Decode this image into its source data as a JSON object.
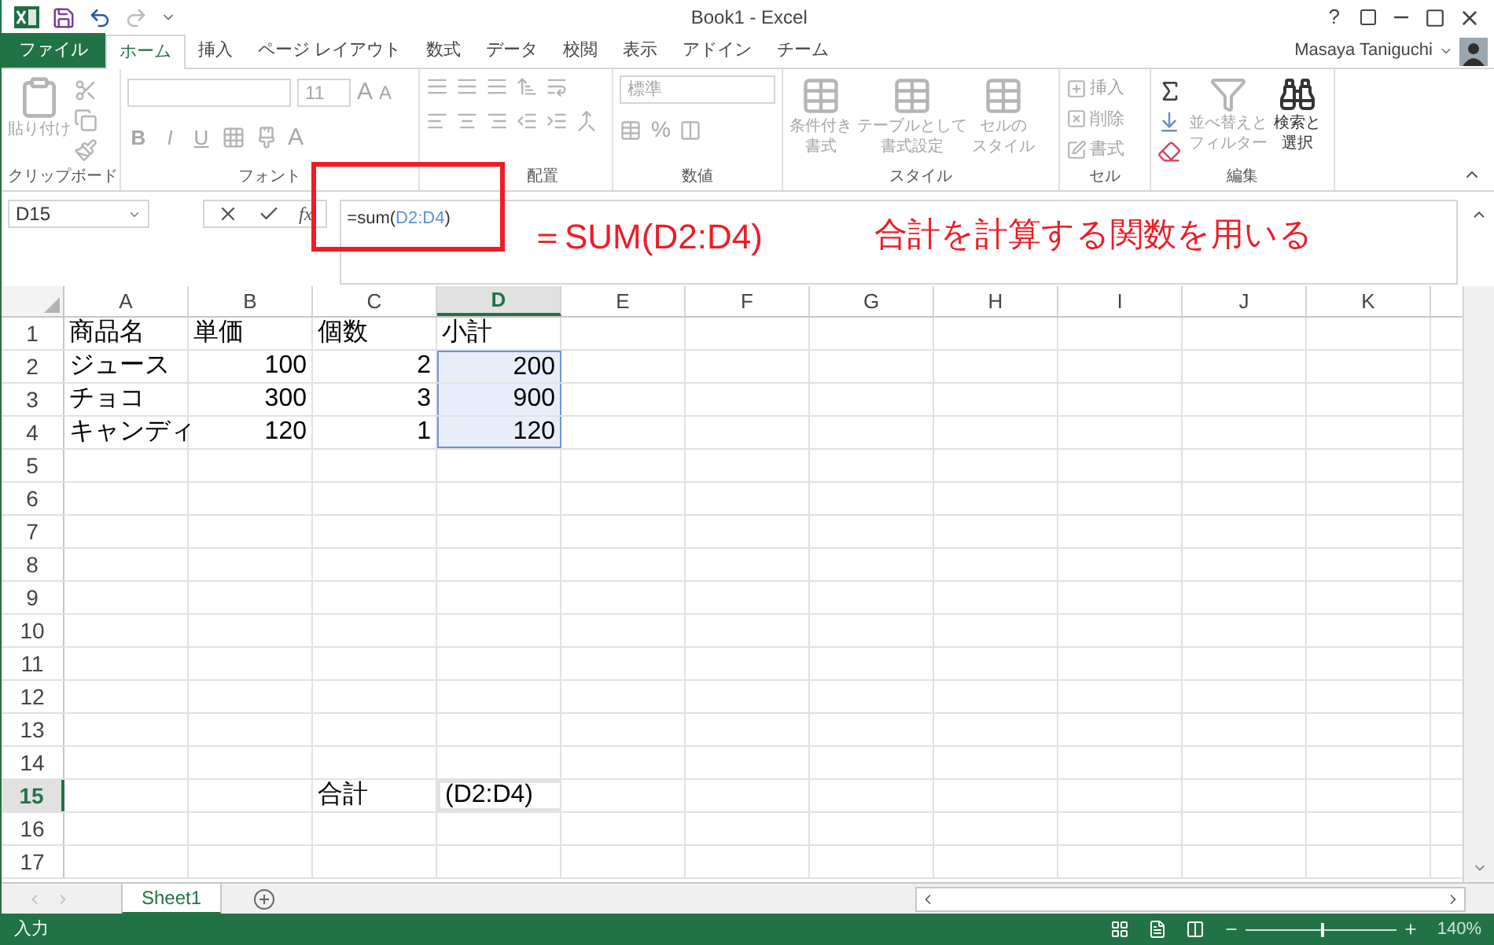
{
  "window": {
    "title": "Book1 - Excel",
    "help": "?"
  },
  "tabs": [
    {
      "label": "ファイル",
      "kind": "file",
      "selected": false
    },
    {
      "label": "ホーム",
      "kind": "tab",
      "selected": true
    },
    {
      "label": "挿入",
      "kind": "tab",
      "selected": false
    },
    {
      "label": "ページ レイアウト",
      "kind": "tab",
      "selected": false
    },
    {
      "label": "数式",
      "kind": "tab",
      "selected": false
    },
    {
      "label": "データ",
      "kind": "tab",
      "selected": false
    },
    {
      "label": "校閲",
      "kind": "tab",
      "selected": false
    },
    {
      "label": "表示",
      "kind": "tab",
      "selected": false
    },
    {
      "label": "アドイン",
      "kind": "tab",
      "selected": false
    },
    {
      "label": "チーム",
      "kind": "tab",
      "selected": false
    }
  ],
  "user": {
    "name": "Masaya Taniguchi"
  },
  "ribbon": {
    "groups": [
      {
        "label": "クリップボード",
        "kind": "clipboard",
        "buttons": [
          {
            "lines": [
              "貼り付け"
            ]
          }
        ]
      },
      {
        "label": "フォント",
        "kind": "font",
        "size": "11",
        "styles": [
          "B",
          "I",
          "U"
        ],
        "grow_letter": "A",
        "shrink_letter": "A",
        "color_letter": "A"
      },
      {
        "label": "配置",
        "kind": "align"
      },
      {
        "label": "数値",
        "kind": "number",
        "format": "標準",
        "percent": "%"
      },
      {
        "label": "スタイル",
        "kind": "styles",
        "buttons": [
          {
            "lines": [
              "条件付き",
              "書式"
            ]
          },
          {
            "lines": [
              "テーブルとして",
              "書式設定"
            ]
          },
          {
            "lines": [
              "セルの",
              "スタイル"
            ]
          }
        ]
      },
      {
        "label": "セル",
        "kind": "cells",
        "buttons": [
          {
            "lines": [
              "挿入"
            ]
          },
          {
            "lines": [
              "削除"
            ]
          },
          {
            "lines": [
              "書式"
            ]
          }
        ]
      },
      {
        "label": "編集",
        "kind": "edit",
        "buttons": [
          {
            "lines": [
              "並べ替えと",
              "フィルター"
            ],
            "disabled": true
          },
          {
            "lines": [
              "検索と",
              "選択"
            ],
            "disabled": false
          }
        ]
      }
    ]
  },
  "formula_bar": {
    "name_box": "D15",
    "fx": "fx",
    "formula": [
      {
        "text": "=sum(",
        "kind": "plain"
      },
      {
        "text": "D2:D4",
        "kind": "ref"
      },
      {
        "text": ")",
        "kind": "plain"
      }
    ]
  },
  "annotations": [
    {
      "text": "＝SUM(D2:D4)"
    },
    {
      "text": "合計を計算する関数を用いる"
    }
  ],
  "sheet": {
    "columns": [
      {
        "label": "A",
        "selected": false
      },
      {
        "label": "B",
        "selected": false
      },
      {
        "label": "C",
        "selected": false
      },
      {
        "label": "D",
        "selected": true
      },
      {
        "label": "E",
        "selected": false
      },
      {
        "label": "F",
        "selected": false
      },
      {
        "label": "G",
        "selected": false
      },
      {
        "label": "H",
        "selected": false
      },
      {
        "label": "I",
        "selected": false
      },
      {
        "label": "J",
        "selected": false
      },
      {
        "label": "K",
        "selected": false
      }
    ],
    "rows": [
      {
        "label": "1",
        "selected": false,
        "cells": [
          {
            "text": "商品名",
            "kind": "text"
          },
          {
            "text": "単価",
            "kind": "text"
          },
          {
            "text": "個数",
            "kind": "text"
          },
          {
            "text": "小計",
            "kind": "text"
          }
        ]
      },
      {
        "label": "2",
        "selected": false,
        "cells": [
          {
            "text": "ジュース",
            "kind": "text"
          },
          {
            "text": "100",
            "kind": "number"
          },
          {
            "text": "2",
            "kind": "number"
          },
          {
            "text": "200",
            "kind": "number",
            "in_range": true
          }
        ]
      },
      {
        "label": "3",
        "selected": false,
        "cells": [
          {
            "text": "チョコ",
            "kind": "text"
          },
          {
            "text": "300",
            "kind": "number"
          },
          {
            "text": "3",
            "kind": "number"
          },
          {
            "text": "900",
            "kind": "number",
            "in_range": true
          }
        ]
      },
      {
        "label": "4",
        "selected": false,
        "cells": [
          {
            "text": "キャンディ",
            "kind": "text"
          },
          {
            "text": "120",
            "kind": "number"
          },
          {
            "text": "1",
            "kind": "number"
          },
          {
            "text": "120",
            "kind": "number",
            "in_range": true
          }
        ]
      },
      {
        "label": "5",
        "selected": false,
        "cells": []
      },
      {
        "label": "6",
        "selected": false,
        "cells": []
      },
      {
        "label": "7",
        "selected": false,
        "cells": []
      },
      {
        "label": "8",
        "selected": false,
        "cells": []
      },
      {
        "label": "9",
        "selected": false,
        "cells": []
      },
      {
        "label": "10",
        "selected": false,
        "cells": []
      },
      {
        "label": "11",
        "selected": false,
        "cells": []
      },
      {
        "label": "12",
        "selected": false,
        "cells": []
      },
      {
        "label": "13",
        "selected": false,
        "cells": []
      },
      {
        "label": "14",
        "selected": false,
        "cells": []
      },
      {
        "label": "15",
        "selected": true,
        "cells": [
          {},
          {},
          {
            "text": "合計",
            "kind": "text"
          },
          {
            "text": "(D2:D4)",
            "kind": "text",
            "active": true
          }
        ]
      },
      {
        "label": "16",
        "selected": false,
        "cells": []
      },
      {
        "label": "17",
        "selected": false,
        "cells": []
      }
    ]
  },
  "sheet_tabs": [
    {
      "label": "Sheet1",
      "selected": true
    }
  ],
  "status_bar": {
    "mode": "入力",
    "zoom": {
      "level": 0.5,
      "reading": "140%"
    }
  }
}
